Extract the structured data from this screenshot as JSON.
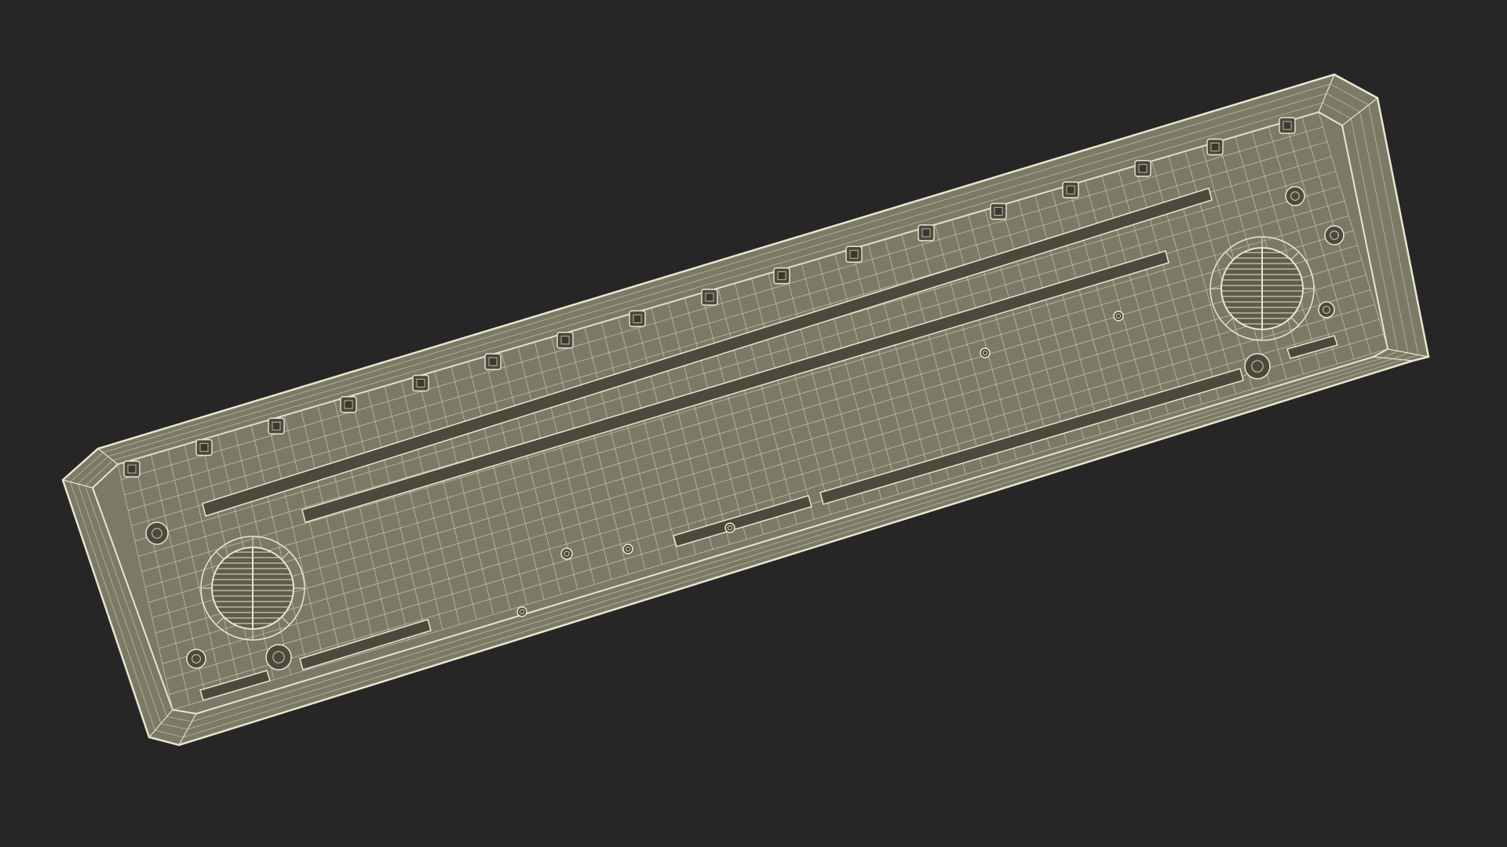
{
  "scene": {
    "subject": "wireframe-render",
    "colors": {
      "background": "#262626",
      "body_fill": "#7c7a67",
      "body_fill_dark": "#5f5d4c",
      "wire": "#e9e6cf",
      "wire_faint": "#d6d2b8",
      "slot_fill": "#4b4a3d",
      "slot_shadow": "#3a392f"
    },
    "grid": {
      "columns": 72,
      "rows": 16
    },
    "upper_studs": 17,
    "features": [
      "outer-frame",
      "long-slots",
      "round-vents",
      "mounting-studs",
      "wire-mesh"
    ]
  }
}
